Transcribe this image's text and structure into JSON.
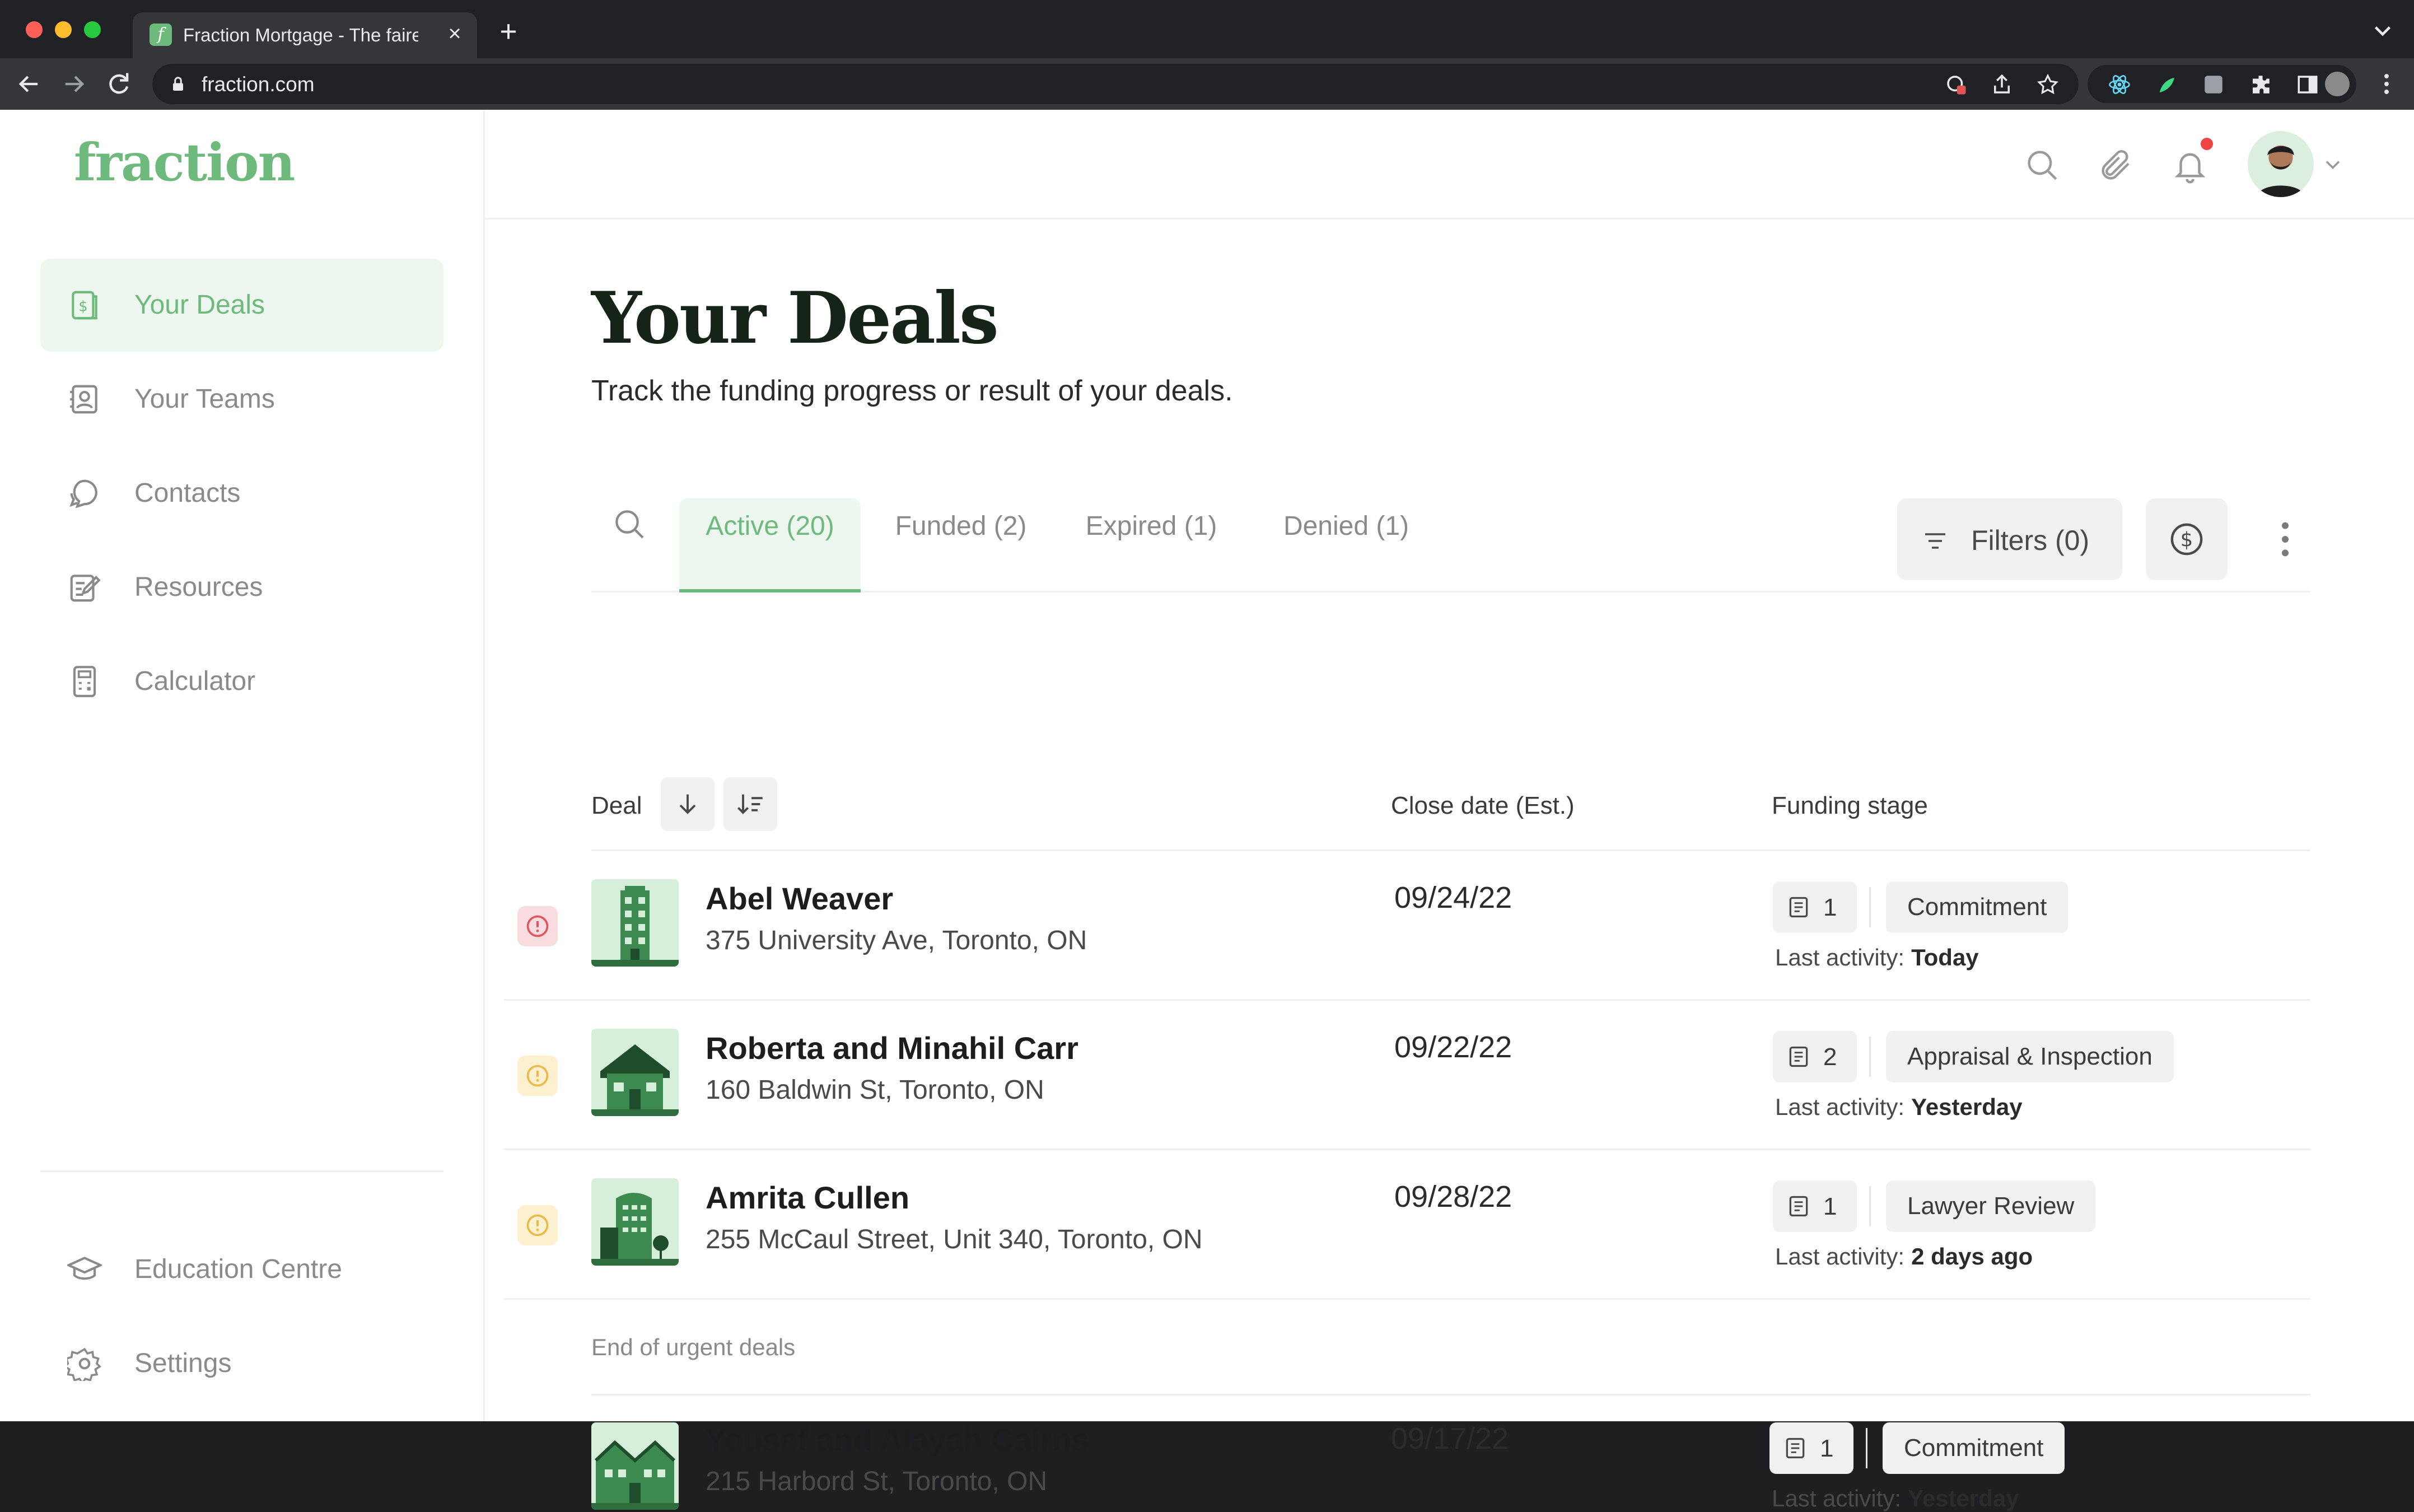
{
  "browser": {
    "tab_title": "Fraction Mortgage - The fairest",
    "favicon_letter": "f",
    "new_tab_symbol": "+",
    "close_symbol": "×",
    "url": "fraction.com"
  },
  "app": {
    "logo": "fraction"
  },
  "sidebar": {
    "items": [
      {
        "label": "Your Deals",
        "icon": "dollar-doc-icon",
        "active": true
      },
      {
        "label": "Your Teams",
        "icon": "contact-card-icon"
      },
      {
        "label": "Contacts",
        "icon": "chat-bubble-icon"
      },
      {
        "label": "Resources",
        "icon": "edit-note-icon"
      },
      {
        "label": "Calculator",
        "icon": "calculator-icon"
      }
    ],
    "bottom_items": [
      {
        "label": "Education Centre",
        "icon": "graduation-cap-icon"
      },
      {
        "label": "Settings",
        "icon": "gear-icon"
      }
    ]
  },
  "page": {
    "title": "Your Deals",
    "subtitle": "Track the funding progress or result of your deals."
  },
  "tabs": [
    {
      "label": "Active (20)",
      "active": true
    },
    {
      "label": "Funded (2)"
    },
    {
      "label": "Expired (1)"
    },
    {
      "label": "Denied (1)"
    }
  ],
  "filters": {
    "label": "Filters (0)"
  },
  "table": {
    "headers": {
      "deal": "Deal",
      "close_date": "Close date (Est.)",
      "funding_stage": "Funding stage"
    },
    "last_activity_label": "Last activity:",
    "rows": [
      {
        "name": "Abel Weaver",
        "address": "375 University Ave, Toronto, ON",
        "close_date": "09/24/22",
        "docs": "1",
        "stage": "Commitment",
        "last_activity": "Today",
        "urgency": "high",
        "thumb": "tower"
      },
      {
        "name": "Roberta and Minahil Carr",
        "address": "160 Baldwin St, Toronto, ON",
        "close_date": "09/22/22",
        "docs": "2",
        "stage": "Appraisal & Inspection",
        "last_activity": "Yesterday",
        "urgency": "medium",
        "thumb": "house"
      },
      {
        "name": "Amrita Cullen",
        "address": "255 McCaul Street, Unit 340, Toronto, ON",
        "close_date": "09/28/22",
        "docs": "1",
        "stage": "Lawyer Review",
        "last_activity": "2 days ago",
        "urgency": "medium",
        "thumb": "condo"
      },
      {
        "name": "Yousef and Alayah Cairns",
        "address": "215 Harbord St, Toronto, ON",
        "close_date": "09/17/22",
        "docs": "1",
        "stage": "Commitment",
        "last_activity": "Yesterday",
        "urgency": "none",
        "thumb": "townhouse"
      }
    ],
    "end_of_urgent": "End of urgent deals"
  },
  "colors": {
    "brand_green": "#6dba7c",
    "active_bg": "#edf7ef",
    "urgent_red": "#e0555e",
    "urgent_yellow": "#e9b949"
  }
}
